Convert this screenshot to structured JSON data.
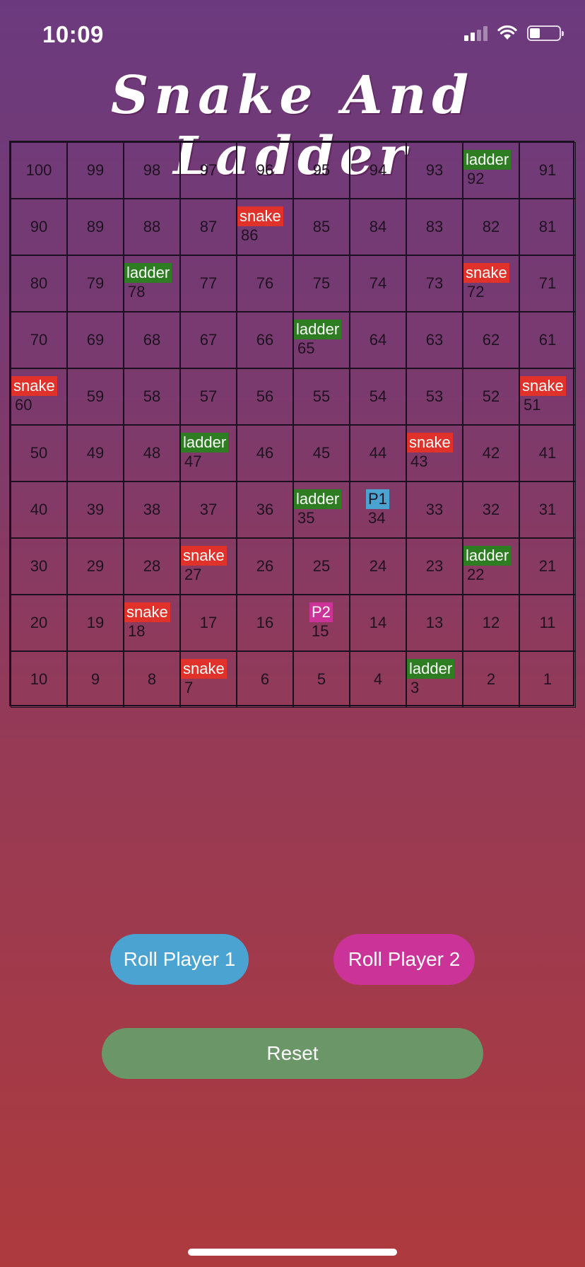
{
  "status": {
    "time": "10:09"
  },
  "title": "Snake And Ladder",
  "board": {
    "rows": [
      [
        {
          "n": "100"
        },
        {
          "n": "99"
        },
        {
          "n": "98"
        },
        {
          "n": "97"
        },
        {
          "n": "96"
        },
        {
          "n": "95"
        },
        {
          "n": "94"
        },
        {
          "n": "93"
        },
        {
          "n": "92",
          "tag": "ladder"
        },
        {
          "n": "91"
        }
      ],
      [
        {
          "n": "90"
        },
        {
          "n": "89"
        },
        {
          "n": "88"
        },
        {
          "n": "87"
        },
        {
          "n": "86",
          "tag": "snake"
        },
        {
          "n": "85"
        },
        {
          "n": "84"
        },
        {
          "n": "83"
        },
        {
          "n": "82"
        },
        {
          "n": "81"
        }
      ],
      [
        {
          "n": "80"
        },
        {
          "n": "79"
        },
        {
          "n": "78",
          "tag": "ladder"
        },
        {
          "n": "77"
        },
        {
          "n": "76"
        },
        {
          "n": "75"
        },
        {
          "n": "74"
        },
        {
          "n": "73"
        },
        {
          "n": "72",
          "tag": "snake"
        },
        {
          "n": "71"
        }
      ],
      [
        {
          "n": "70"
        },
        {
          "n": "69"
        },
        {
          "n": "68"
        },
        {
          "n": "67"
        },
        {
          "n": "66"
        },
        {
          "n": "65",
          "tag": "ladder"
        },
        {
          "n": "64"
        },
        {
          "n": "63"
        },
        {
          "n": "62"
        },
        {
          "n": "61"
        }
      ],
      [
        {
          "n": "60",
          "tag": "snake"
        },
        {
          "n": "59"
        },
        {
          "n": "58"
        },
        {
          "n": "57"
        },
        {
          "n": "56"
        },
        {
          "n": "55"
        },
        {
          "n": "54"
        },
        {
          "n": "53"
        },
        {
          "n": "52"
        },
        {
          "n": "51",
          "tag": "snake"
        }
      ],
      [
        {
          "n": "50"
        },
        {
          "n": "49"
        },
        {
          "n": "48"
        },
        {
          "n": "47",
          "tag": "ladder"
        },
        {
          "n": "46"
        },
        {
          "n": "45"
        },
        {
          "n": "44"
        },
        {
          "n": "43",
          "tag": "snake"
        },
        {
          "n": "42"
        },
        {
          "n": "41"
        }
      ],
      [
        {
          "n": "40"
        },
        {
          "n": "39"
        },
        {
          "n": "38"
        },
        {
          "n": "37"
        },
        {
          "n": "36"
        },
        {
          "n": "35",
          "tag": "ladder"
        },
        {
          "n": "34",
          "tag": "P1"
        },
        {
          "n": "33"
        },
        {
          "n": "32"
        },
        {
          "n": "31"
        }
      ],
      [
        {
          "n": "30"
        },
        {
          "n": "29"
        },
        {
          "n": "28"
        },
        {
          "n": "27",
          "tag": "snake"
        },
        {
          "n": "26"
        },
        {
          "n": "25"
        },
        {
          "n": "24"
        },
        {
          "n": "23"
        },
        {
          "n": "22",
          "tag": "ladder"
        },
        {
          "n": "21"
        }
      ],
      [
        {
          "n": "20"
        },
        {
          "n": "19"
        },
        {
          "n": "18",
          "tag": "snake"
        },
        {
          "n": "17"
        },
        {
          "n": "16"
        },
        {
          "n": "15",
          "tag": "P2"
        },
        {
          "n": "14"
        },
        {
          "n": "13"
        },
        {
          "n": "12"
        },
        {
          "n": "11"
        }
      ],
      [
        {
          "n": "10"
        },
        {
          "n": "9"
        },
        {
          "n": "8"
        },
        {
          "n": "7",
          "tag": "snake"
        },
        {
          "n": "6"
        },
        {
          "n": "5"
        },
        {
          "n": "4"
        },
        {
          "n": "3",
          "tag": "ladder"
        },
        {
          "n": "2"
        },
        {
          "n": "1"
        }
      ]
    ]
  },
  "buttons": {
    "roll_player_1": "Roll Player 1",
    "roll_player_2": "Roll Player 2",
    "reset": "Reset"
  },
  "colors": {
    "snake": "#e0312b",
    "ladder": "#2e7d22",
    "player_1": "#4aa3d0",
    "player_2": "#cc3399",
    "reset": "#6b9668"
  }
}
